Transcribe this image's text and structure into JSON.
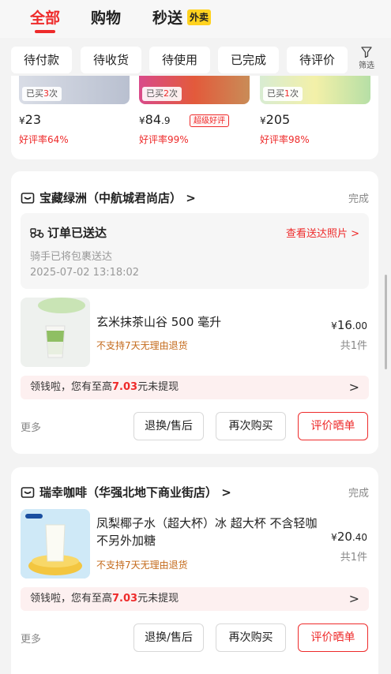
{
  "top_tabs": {
    "all": "全部",
    "shopping": "购物",
    "express": "秒送",
    "takeaway_badge": "外卖"
  },
  "filters": [
    "待付款",
    "待收货",
    "待使用",
    "已完成",
    "待评价"
  ],
  "filter_button": "筛选",
  "recommendations": [
    {
      "bought_prefix": "已买",
      "bought_count": "3",
      "bought_suffix": "次",
      "price_symbol": "¥",
      "price": "23",
      "price_decimal": "",
      "rate": "好评率64%"
    },
    {
      "bought_prefix": "已买",
      "bought_count": "2",
      "bought_suffix": "次",
      "price_symbol": "¥",
      "price": "84",
      "price_decimal": ".9",
      "rate": "好评率99%",
      "badge": "超级好评"
    },
    {
      "bought_prefix": "已买",
      "bought_count": "1",
      "bought_suffix": "次",
      "price_symbol": "¥",
      "price": "205",
      "price_decimal": "",
      "rate": "好评率98%"
    }
  ],
  "orders": [
    {
      "store": "宝藏绿洲（中航城君尚店）",
      "store_chevron": ">",
      "status": "完成",
      "delivery_title": "订单已送达",
      "delivery_photo": "查看送达照片",
      "delivery_photo_chevron": ">",
      "delivery_sub": "骑手已将包裹送达",
      "delivery_time": "2025-07-02 13:18:02",
      "product_name": "玄米抹茶山谷 500 毫升",
      "product_warn": "不支持7天无理由退货",
      "price_symbol": "¥",
      "price_int": "16",
      "price_dec": ".00",
      "qty": "共1件",
      "cash_prefix": "领钱啦，您有至高",
      "cash_amount": "7.03",
      "cash_suffix": "元未提现",
      "cash_chevron": ">",
      "more": "更多",
      "btn_return": "退换/售后",
      "btn_rebuy": "再次购买",
      "btn_review": "评价晒单"
    },
    {
      "store": "瑞幸咖啡（华强北地下商业街店）",
      "store_chevron": ">",
      "status": "完成",
      "product_name": "凤梨椰子水（超大杯）冰 超大杯 不含轻咖 不另外加糖",
      "product_warn": "不支持7天无理由退货",
      "price_symbol": "¥",
      "price_int": "20",
      "price_dec": ".40",
      "qty": "共1件",
      "cash_prefix": "领钱啦，您有至高",
      "cash_amount": "7.03",
      "cash_suffix": "元未提现",
      "cash_chevron": ">",
      "more": "更多",
      "btn_return": "退换/售后",
      "btn_rebuy": "再次购买",
      "btn_review": "评价晒单"
    }
  ],
  "colors": {
    "accent": "#ee2b2b",
    "badge_yellow": "#ffd21f",
    "warn": "#c46a1b"
  }
}
